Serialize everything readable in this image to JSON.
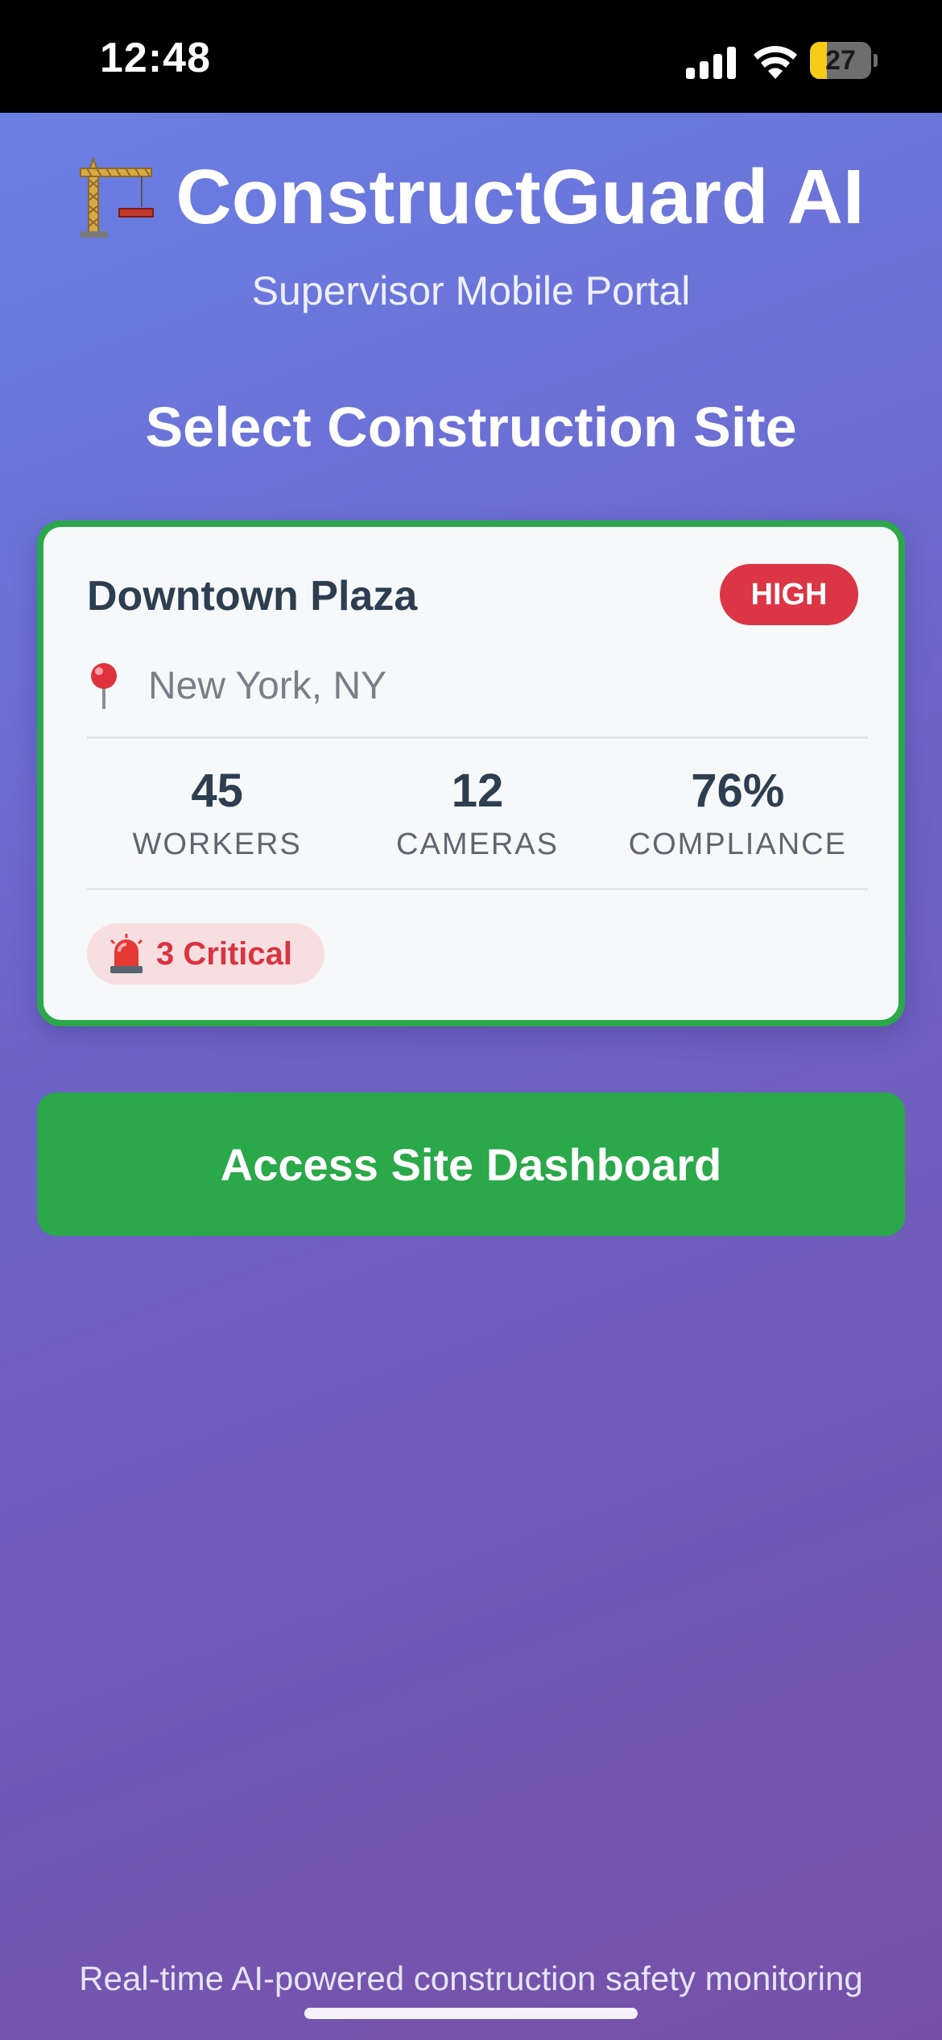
{
  "status_bar": {
    "time": "12:48",
    "battery_level": "27",
    "battery_fraction": 0.27
  },
  "header": {
    "app_icon": "construction-crane-icon",
    "app_title": "ConstructGuard AI",
    "subtitle": "Supervisor Mobile Portal"
  },
  "main": {
    "section_title": "Select Construction Site",
    "site": {
      "name": "Downtown Plaza",
      "risk_level": "HIGH",
      "location_icon": "pin-icon",
      "location": "New York, NY",
      "stats": [
        {
          "value": "45",
          "label": "WORKERS"
        },
        {
          "value": "12",
          "label": "CAMERAS"
        },
        {
          "value": "76%",
          "label": "COMPLIANCE"
        }
      ],
      "alert_icon": "siren-icon",
      "alert": "3 Critical"
    },
    "access_button_label": "Access Site Dashboard"
  },
  "footer": {
    "tagline": "Real-time AI-powered construction safety monitoring"
  },
  "colors": {
    "accent_green": "#2aa84a",
    "risk_red": "#dc3545",
    "gradient_start": "#6a7fe5",
    "gradient_end": "#7650a8"
  }
}
